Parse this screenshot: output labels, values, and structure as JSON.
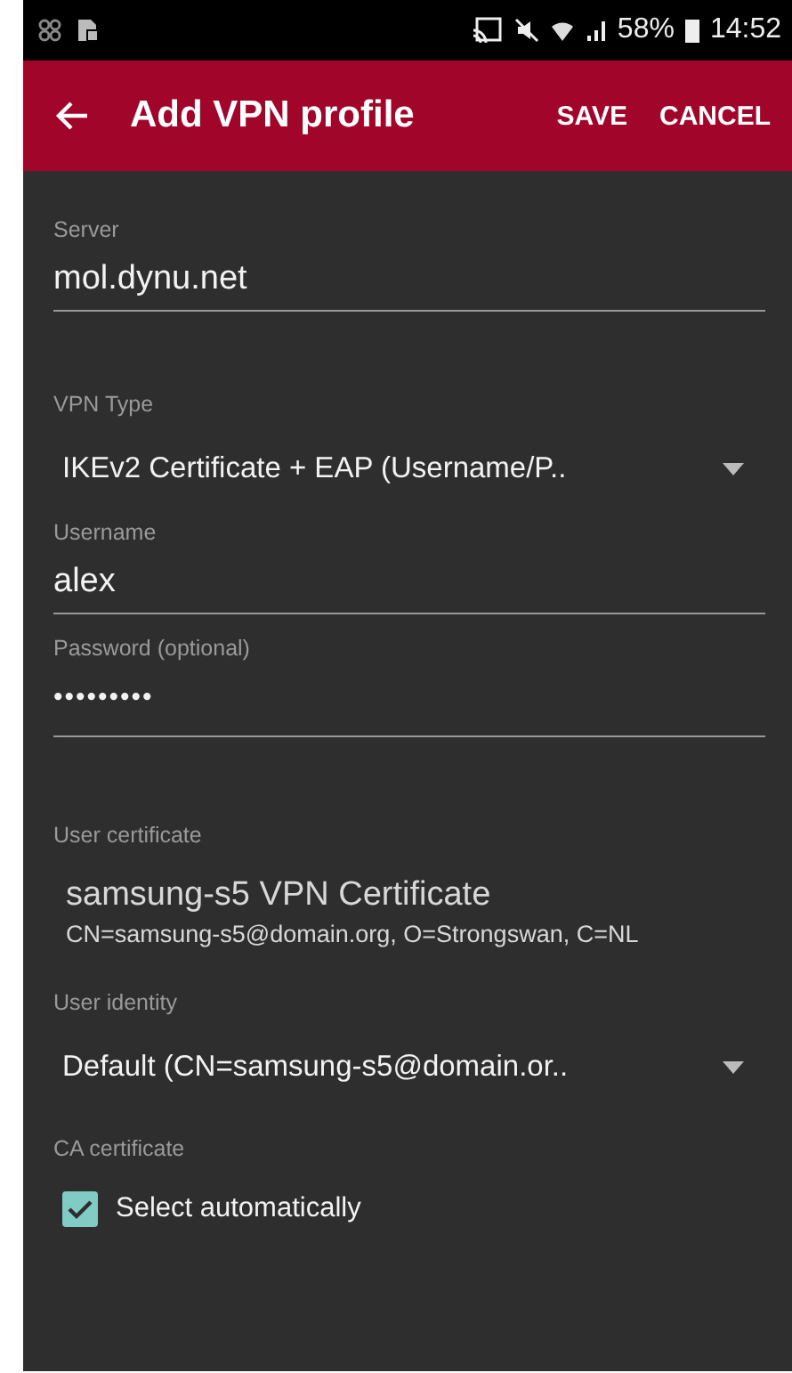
{
  "status_bar": {
    "battery": "58%",
    "time": "14:52"
  },
  "app_bar": {
    "title": "Add VPN profile",
    "actions": [
      "SAVE",
      "CANCEL"
    ]
  },
  "fields": [
    {
      "kind": "text",
      "label": "Server",
      "value": "mol.dynu.net"
    },
    {
      "kind": "dropdown",
      "label": "VPN Type",
      "value": "IKEv2 Certificate + EAP (Username/P.."
    },
    {
      "kind": "text",
      "label": "Username",
      "value": "alex"
    },
    {
      "kind": "password",
      "label": "Password (optional)",
      "value": "•••••••••"
    },
    {
      "kind": "certificate",
      "label": "User certificate",
      "title": "samsung-s5 VPN Certificate",
      "detail": "CN=samsung-s5@domain.org, O=Strongswan, C=NL"
    },
    {
      "kind": "dropdown",
      "label": "User identity",
      "value": "Default (CN=samsung-s5@domain.or.."
    },
    {
      "kind": "checkbox",
      "label": "CA certificate",
      "option": "Select automatically",
      "checked": true
    }
  ]
}
